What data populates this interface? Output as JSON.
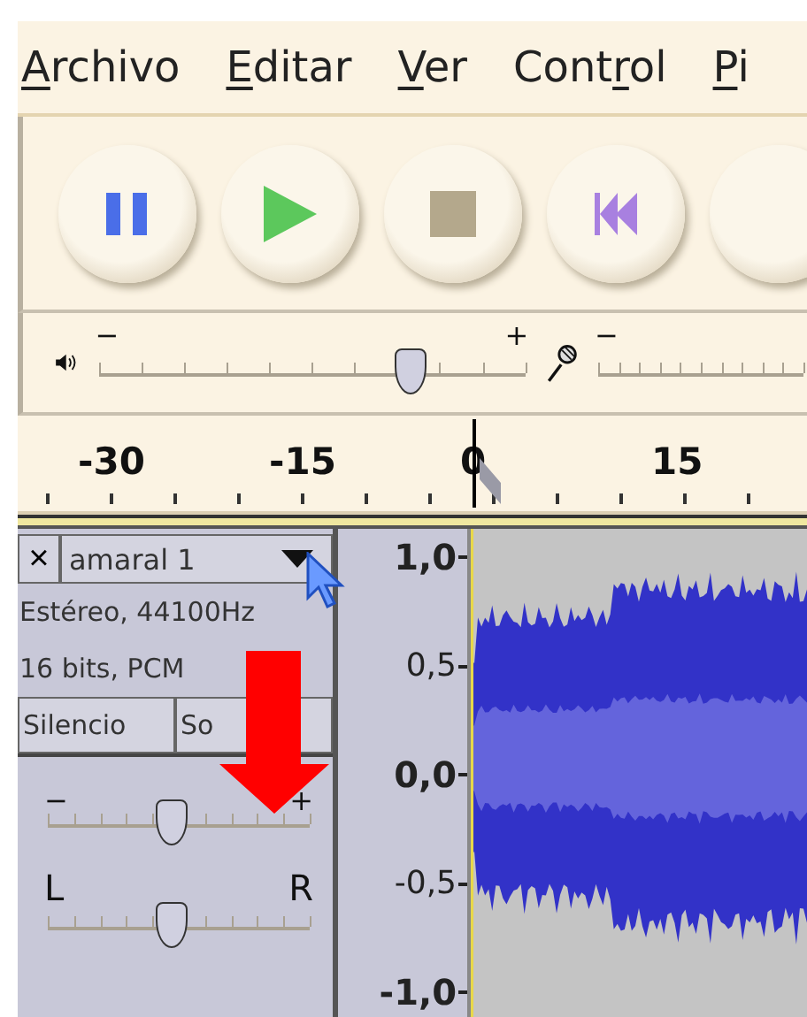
{
  "menu": [
    {
      "parts": [
        {
          "text": "A",
          "underlined": true
        },
        {
          "text": "rchivo",
          "underlined": false
        }
      ]
    },
    {
      "parts": [
        {
          "text": "E",
          "underlined": true
        },
        {
          "text": "ditar",
          "underlined": false
        }
      ]
    },
    {
      "parts": [
        {
          "text": "V",
          "underlined": true
        },
        {
          "text": "er",
          "underlined": false
        }
      ]
    },
    {
      "parts": [
        {
          "text": "Cont",
          "underlined": false
        },
        {
          "text": "r",
          "underlined": true
        },
        {
          "text": "ol",
          "underlined": false
        }
      ]
    },
    {
      "parts": [
        {
          "text": "P",
          "underlined": true
        },
        {
          "text": "i",
          "underlined": false
        }
      ]
    }
  ],
  "transport": [
    {
      "kind": "pause"
    },
    {
      "kind": "play"
    },
    {
      "kind": "stop"
    },
    {
      "kind": "skip-start"
    }
  ],
  "playback_volume": {
    "minus": "−",
    "plus": "+",
    "level": 0.73
  },
  "recording_volume": {
    "minus": "−"
  },
  "ruler": {
    "labels": [
      "-30",
      "-15",
      "0",
      "15"
    ]
  },
  "track": {
    "close": "×",
    "name": "amaral 1",
    "info": [
      "Estéreo, 44100Hz",
      "16 bits, PCM"
    ],
    "buttons": [
      {
        "label": "Silencio"
      },
      {
        "label": "So"
      }
    ],
    "gain": {
      "minus": "−",
      "plus": "+",
      "level": 0.47
    },
    "pan": {
      "left": "L",
      "right": "R",
      "level": 0.47
    },
    "scale": [
      {
        "label": "1,0",
        "major": true
      },
      {
        "label": "0,5",
        "major": false
      },
      {
        "label": "0,0",
        "major": true
      },
      {
        "label": "-0,5",
        "major": false
      },
      {
        "label": "-1,0",
        "major": true
      }
    ]
  }
}
